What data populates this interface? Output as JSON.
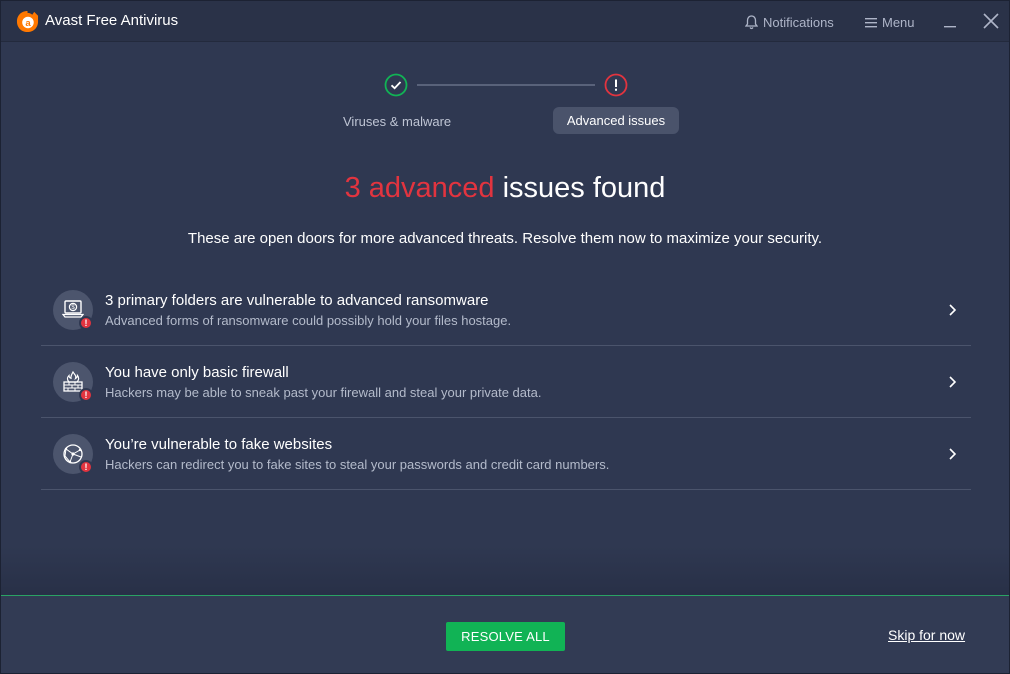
{
  "app": {
    "title": "Avast Free Antivirus"
  },
  "titlebar": {
    "notifications_label": "Notifications",
    "menu_label": "Menu"
  },
  "stepper": {
    "steps": [
      {
        "label": "Viruses & malware",
        "status": "done",
        "icon": "check-icon"
      },
      {
        "label": "Advanced issues",
        "status": "issue",
        "icon": "exclamation-icon"
      }
    ]
  },
  "main": {
    "headline_accent": "3 advanced",
    "headline_rest": " issues found",
    "subtitle": "These are open doors for more advanced threats. Resolve them now to maximize your security."
  },
  "issues": [
    {
      "title": "3 primary folders are vulnerable to advanced ransomware",
      "description": "Advanced forms of ransomware could possibly hold your files hostage.",
      "icon": "ransomware-laptop-icon"
    },
    {
      "title": "You have only basic firewall",
      "description": "Hackers may be able to sneak past your firewall and steal your private data.",
      "icon": "firewall-icon"
    },
    {
      "title": "You’re vulnerable to fake websites",
      "description": "Hackers can redirect you to fake sites to steal your passwords and credit card numbers.",
      "icon": "globe-network-icon"
    }
  ],
  "footer": {
    "resolve_label": "RESOLVE ALL",
    "skip_label": "Skip for now"
  },
  "colors": {
    "background": "#2f3851",
    "accent_red": "#e2343f",
    "success_green": "#11b355",
    "brand_orange": "#ff7800"
  }
}
